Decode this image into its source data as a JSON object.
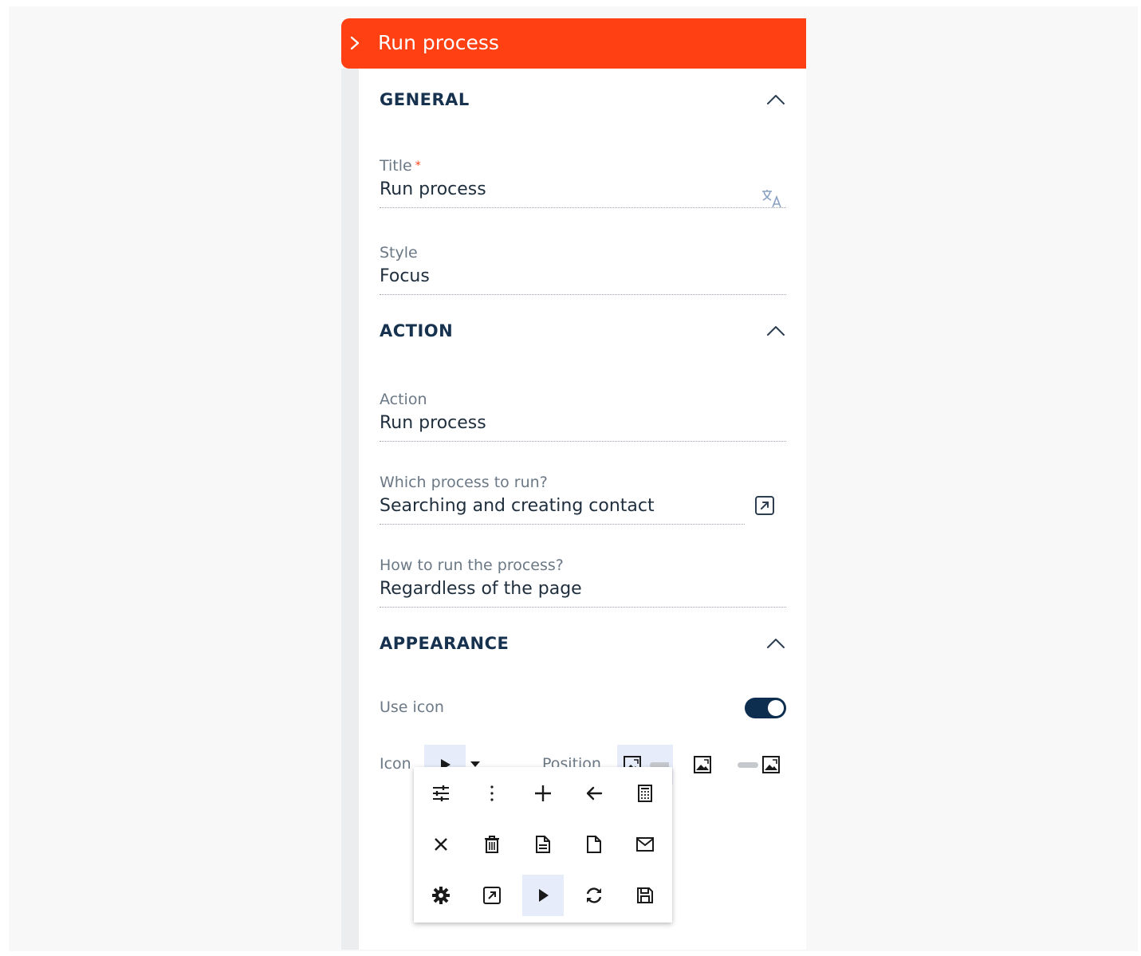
{
  "header": {
    "title": "Run process"
  },
  "sections": {
    "general": {
      "title": "GENERAL"
    },
    "action": {
      "title": "ACTION"
    },
    "appearance": {
      "title": "APPEARANCE"
    }
  },
  "fields": {
    "title": {
      "label": "Title",
      "required_mark": "*",
      "value": "Run process"
    },
    "style": {
      "label": "Style",
      "value": "Focus"
    },
    "action": {
      "label": "Action",
      "value": "Run process"
    },
    "which_process": {
      "label": "Which process to run?",
      "value": "Searching and creating contact"
    },
    "how_to_run": {
      "label": "How to run the process?",
      "value": "Regardless of the page"
    }
  },
  "appearance": {
    "use_icon_label": "Use icon",
    "use_icon_enabled": true,
    "icon_label": "Icon",
    "selected_icon": "play-icon",
    "position_label": "Position",
    "position_options": [
      "icon-left",
      "icon-only",
      "icon-right"
    ],
    "selected_position": "icon-left"
  },
  "icon_picker": [
    [
      "tune-icon",
      "more-vert-icon",
      "plus-icon",
      "arrow-left-icon",
      "calculator-icon"
    ],
    [
      "close-icon",
      "trash-icon",
      "document-icon",
      "file-icon",
      "mail-icon"
    ],
    [
      "gear-icon",
      "open-external-icon",
      "play-icon",
      "refresh-icon",
      "save-icon"
    ]
  ],
  "colors": {
    "header": "#ff4013",
    "toggle": "#0d2e4e",
    "selected_bg": "#e6ecfa",
    "heading": "#16324f"
  }
}
